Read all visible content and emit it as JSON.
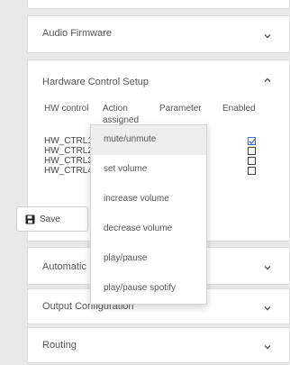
{
  "panels": {
    "audio_firmware": "Audio Firmware",
    "hardware_control": "Hardware Control Setup",
    "automatic": "Automatic",
    "output_configuration": "Output Configuration",
    "routing": "Routing"
  },
  "table": {
    "headers": {
      "hw_control": "HW control",
      "action": "Action assigned",
      "parameter": "Parameter",
      "enabled": "Enabled"
    },
    "rows": [
      {
        "label": "HW_CTRL1",
        "enabled": true
      },
      {
        "label": "HW_CTRL2",
        "enabled": false
      },
      {
        "label": "HW_CTRL3",
        "enabled": false
      },
      {
        "label": "HW_CTRL4",
        "enabled": false
      }
    ]
  },
  "save_button": {
    "label": "Save",
    "icon": "floppy-disk-icon"
  },
  "dropdown": {
    "selected": "mute/unmute",
    "options": [
      "mute/unmute",
      "set volume",
      "increase volume",
      "decrease volume",
      "play/pause",
      "play/pause spotify"
    ]
  }
}
